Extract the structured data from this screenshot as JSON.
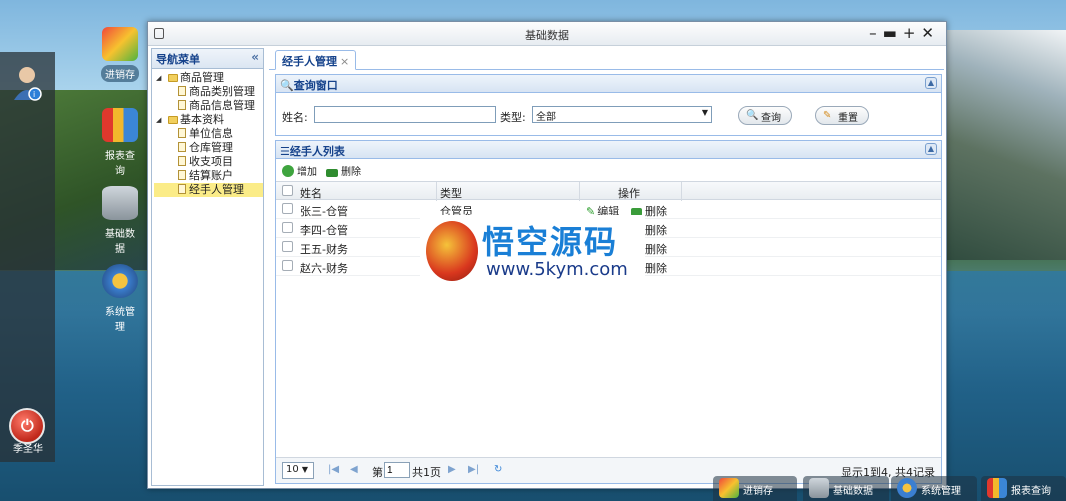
{
  "desktop": {
    "user_name": "季圣华",
    "icons": [
      {
        "label": "进销存",
        "icon": "package-cubes-icon",
        "selected": true
      },
      {
        "label": "报表查询",
        "icon": "bar-chart-icon",
        "selected": false
      },
      {
        "label": "基础数据",
        "icon": "database-icon",
        "selected": false
      },
      {
        "label": "系统管理",
        "icon": "gears-icon",
        "selected": false
      }
    ]
  },
  "window": {
    "title": "基础数据",
    "controls": [
      "minimize",
      "maximize",
      "add",
      "close"
    ]
  },
  "sidebar": {
    "title": "导航菜单",
    "tree": [
      {
        "label": "商品管理",
        "children": [
          "商品类别管理",
          "商品信息管理"
        ]
      },
      {
        "label": "基本资料",
        "children": [
          "单位信息",
          "仓库管理",
          "收支项目",
          "结算账户",
          "经手人管理"
        ]
      }
    ],
    "active_item": "经手人管理"
  },
  "tab": {
    "label": "经手人管理",
    "close": "×"
  },
  "query": {
    "title": "查询窗口",
    "name_label": "姓名:",
    "name_value": "",
    "type_label": "类型:",
    "type_value": "全部",
    "search_button": "查询",
    "reset_button": "重置"
  },
  "list": {
    "title": "经手人列表",
    "add_label": "增加",
    "delete_label": "删除",
    "columns": [
      "姓名",
      "类型",
      "操作"
    ],
    "rows": [
      {
        "name": "张三-仓管",
        "type": "仓管员",
        "edit": "编辑",
        "del": "删除"
      },
      {
        "name": "李四-仓管",
        "type": "",
        "edit": "",
        "del": "删除"
      },
      {
        "name": "王五-财务",
        "type": "",
        "edit": "",
        "del": "删除"
      },
      {
        "name": "赵六-财务",
        "type": "",
        "edit": "",
        "del": "删除"
      }
    ]
  },
  "pager": {
    "page_size": "10",
    "page_prefix": "第",
    "page_value": "1",
    "page_total": "共1页",
    "summary": "显示1到4, 共4记录"
  },
  "watermark": {
    "title": "悟空源码",
    "url": "www.5kym.com"
  },
  "taskbar": [
    {
      "label": "进销存",
      "icon": "package-cubes-icon"
    },
    {
      "label": "基础数据",
      "icon": "database-icon"
    },
    {
      "label": "系统管理",
      "icon": "gears-icon"
    },
    {
      "label": "报表查询",
      "icon": "bar-chart-icon"
    }
  ],
  "colors": {
    "accent": "#15428b",
    "border": "#99bbe8",
    "active_row": "#fbec88"
  }
}
